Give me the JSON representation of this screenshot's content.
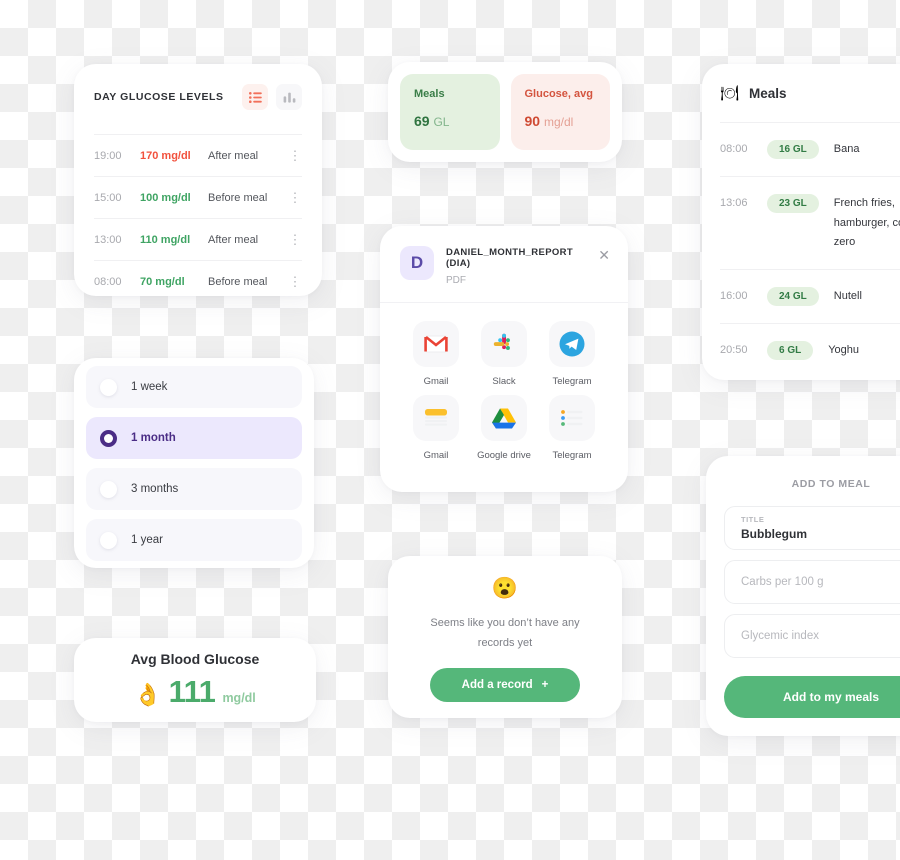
{
  "glucose_card": {
    "title": "DAY GLUCOSE LEVELS",
    "view_list_icon": "list-icon",
    "view_chart_icon": "bar-chart-icon",
    "rows": [
      {
        "time": "19:00",
        "value": "170 mg/dl",
        "note": "After meal",
        "state": "high",
        "menu": "⋮"
      },
      {
        "time": "15:00",
        "value": "100 mg/dl",
        "note": "Before meal",
        "state": "ok",
        "menu": "⋮"
      },
      {
        "time": "13:00",
        "value": "110 mg/dl",
        "note": "After meal",
        "state": "ok",
        "menu": "⋮"
      },
      {
        "time": "08:00",
        "value": "70 mg/dl",
        "note": "Before meal",
        "state": "ok",
        "menu": "⋮"
      }
    ]
  },
  "period_card": {
    "options": [
      {
        "label": "1 week",
        "selected": false
      },
      {
        "label": "1 month",
        "selected": true
      },
      {
        "label": "3 months",
        "selected": false
      },
      {
        "label": "1 year",
        "selected": false
      }
    ]
  },
  "avg_card": {
    "title": "Avg Blood Glucose",
    "emoji": "👌",
    "value": "111",
    "unit": "mg/dl"
  },
  "stats_card": {
    "meals": {
      "label": "Meals",
      "value": "69",
      "unit": "GL"
    },
    "glucose": {
      "label": "Glucose, avg",
      "value": "90",
      "unit": "mg/dl"
    }
  },
  "share_card": {
    "file_initial": "D",
    "file_name": "DANIEL_MONTH_REPORT (DIA)",
    "file_type": "PDF",
    "close_icon": "✕",
    "apps": [
      {
        "name": "Gmail",
        "icon": "gmail-icon"
      },
      {
        "name": "Slack",
        "icon": "slack-icon"
      },
      {
        "name": "Telegram",
        "icon": "telegram-icon"
      },
      {
        "name": "Gmail",
        "icon": "notes-icon"
      },
      {
        "name": "Google drive",
        "icon": "google-drive-icon"
      },
      {
        "name": "Telegram",
        "icon": "list-lines-icon"
      }
    ]
  },
  "empty_card": {
    "emoji": "😮",
    "message": "Seems like you don’t have any records yet",
    "button_label": "Add a record",
    "button_icon": "+"
  },
  "meals_card": {
    "icon": "🍽",
    "title": "Meals",
    "rows": [
      {
        "time": "08:00",
        "gl": "16 GL",
        "name": "Bana"
      },
      {
        "time": "13:06",
        "gl": "23 GL",
        "name": "French fries, hamburger, coca zero"
      },
      {
        "time": "16:00",
        "gl": "24 GL",
        "name": "Nutell"
      },
      {
        "time": "20:50",
        "gl": "6 GL",
        "name": "Yoghu"
      }
    ]
  },
  "add_meal_card": {
    "title": "ADD TO MEAL",
    "fields": [
      {
        "label": "TITLE",
        "value": "Bubblegum",
        "placeholder": ""
      },
      {
        "label": "",
        "value": "",
        "placeholder": "Carbs per 100 g"
      },
      {
        "label": "",
        "value": "",
        "placeholder": "Glycemic index"
      }
    ],
    "submit_label": "Add to my meals"
  },
  "colors": {
    "green": "#55b77a",
    "red": "#f2513d",
    "purple": "#4b2d86",
    "green_chip_bg": "#e4f1e0",
    "red_chip_bg": "#fceeeb"
  }
}
